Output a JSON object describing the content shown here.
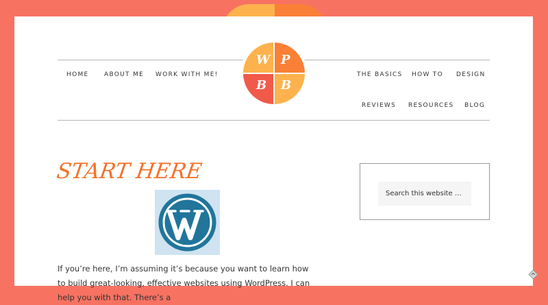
{
  "nav_left": [
    "HOME",
    "ABOUT ME",
    "WORK WITH ME!"
  ],
  "nav_right_row1": [
    "THE BASICS",
    "HOW TO",
    "DESIGN"
  ],
  "nav_right_row2": [
    "REVIEWS",
    "RESOURCES",
    "BLOG"
  ],
  "logo": {
    "letters": [
      "W",
      "P",
      "B",
      "B"
    ]
  },
  "post": {
    "title": "START HERE",
    "image_icon": "wordpress-logo-icon",
    "body": "If you’re here, I’m assuming it’s because you want to learn how to build great-looking, effective websites using WordPress. I can help you with that. There’s a"
  },
  "sidebar": {
    "search_placeholder": "Search this website …"
  },
  "colors": {
    "background": "#f87262",
    "title": "#f4722b",
    "logo_yellow": "#fdb24d",
    "logo_orange": "#f98036",
    "logo_red": "#f15a4a",
    "wordpress_blue": "#21759b"
  }
}
